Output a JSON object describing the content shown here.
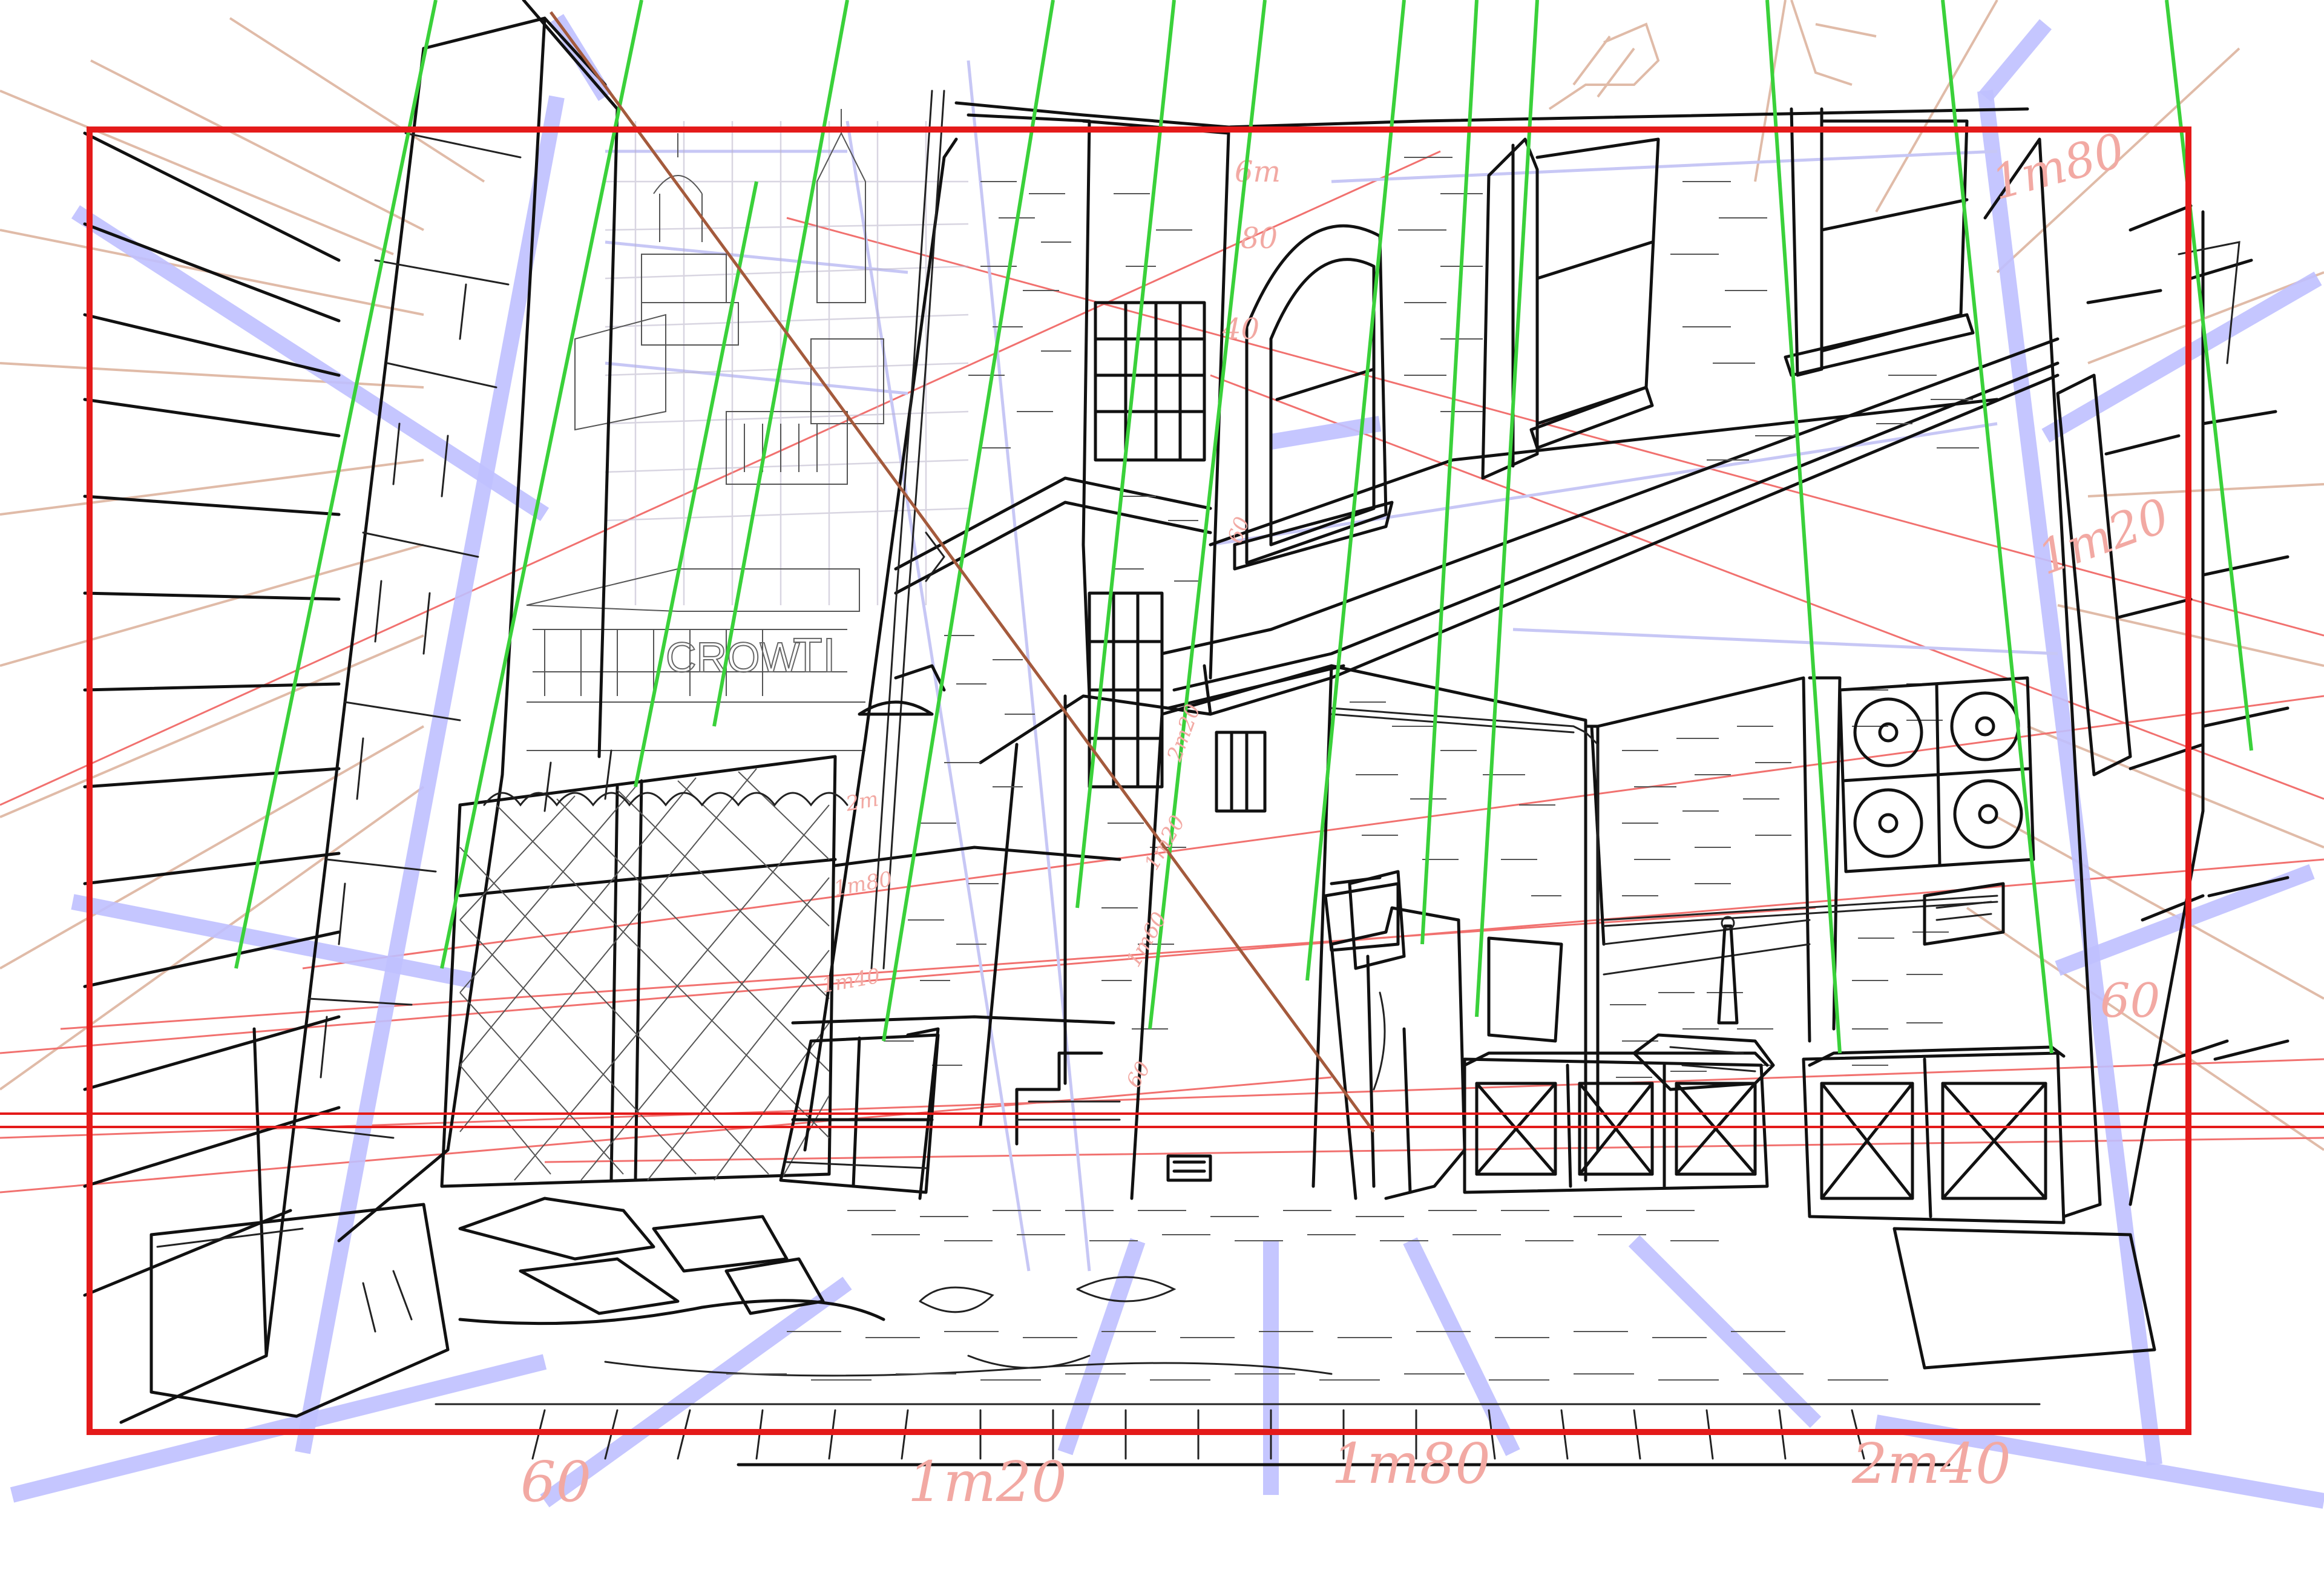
{
  "canvas": {
    "background": "#ffffff"
  },
  "colors": {
    "frame": "#e41a1a",
    "horizon": "#e41a1a",
    "verticals": "#3ad13a",
    "perspective_blue": "#bfc0ff",
    "perspective_tan": "#e0bba8",
    "annotation": "#f2a9a3",
    "ink": "#111111"
  },
  "annotations": {
    "bottom": [
      "60",
      "1m20",
      "1m80",
      "2m40"
    ],
    "right_side": [
      "1m80",
      "1m20",
      "60"
    ],
    "building_scale": [
      "6m",
      "80",
      "40"
    ],
    "left_wall": [
      "2m20",
      "2m",
      "1m80",
      "1m60",
      "1m40",
      "1m20",
      "60"
    ],
    "small_marks": [
      "60"
    ]
  }
}
